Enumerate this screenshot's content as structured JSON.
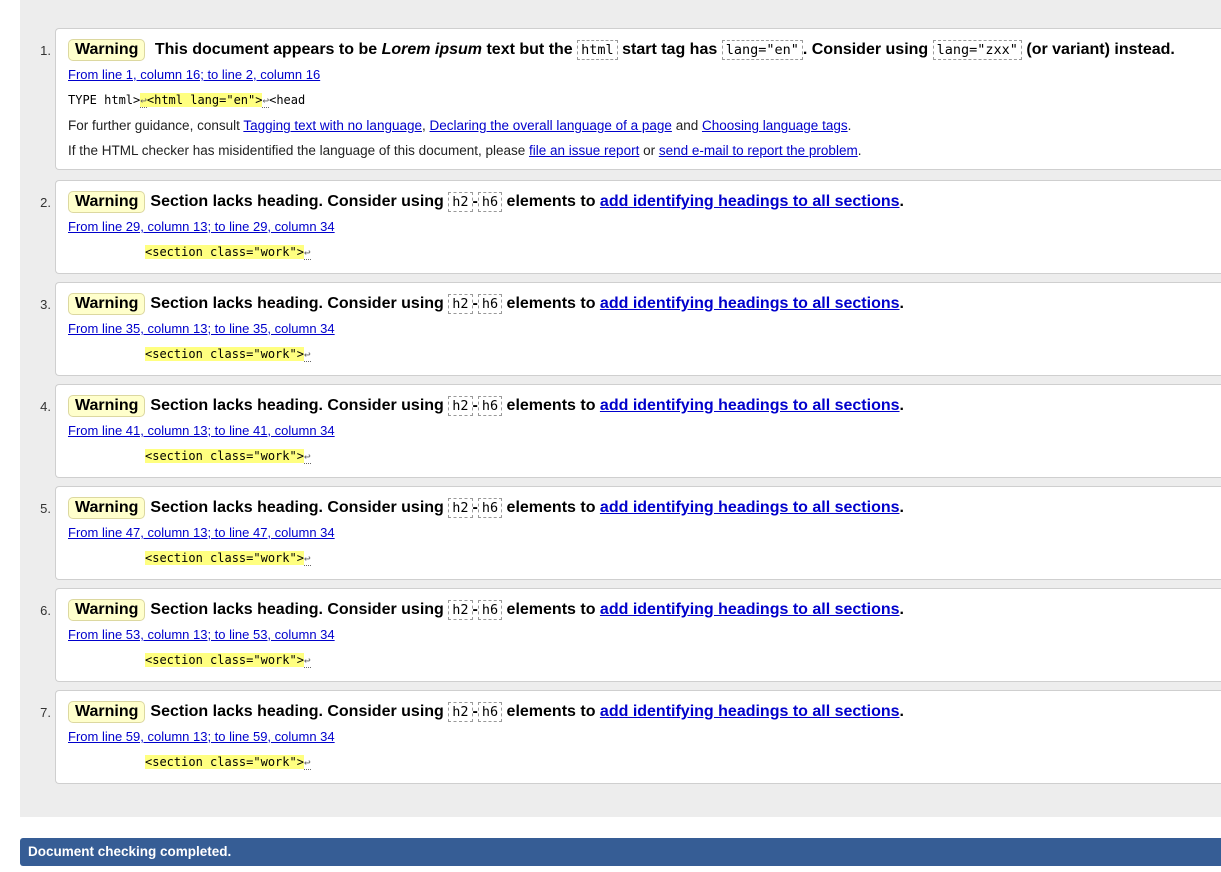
{
  "messages": [
    {
      "num": "1.",
      "badge": "Warning",
      "t1": "This document appears to be ",
      "em": "Lorem ipsum",
      "t2": " text but the ",
      "code1": "html",
      "t3": " start tag has ",
      "code2": "lang=\"en\"",
      "t4": ". Consider using ",
      "code3": "lang=\"zxx\"",
      "t5": " (or variant) instead.",
      "location": "From line 1, column 16; to line 2, column 16",
      "extract_pre": "TYPE html>",
      "extract_hl": "<html lang=\"en\">",
      "extract_post": "<head",
      "extract_rt": "↩",
      "guidance_prefix": "For further guidance, consult ",
      "guidance_link1": "Tagging text with no language",
      "guidance_comma": ", ",
      "guidance_link2": "Declaring the overall language of a page",
      "guidance_and": " and ",
      "guidance_link3": "Choosing language tags",
      "guidance_end": ".",
      "report_prefix": "If the HTML checker has misidentified the language of this document, please ",
      "report_link1": "file an issue report",
      "report_or": " or ",
      "report_link2": "send e-mail to report the problem",
      "report_end": "."
    }
  ],
  "section_warnings": [
    {
      "num": "2.",
      "location": "From line 29, column 13; to line 29, column 34"
    },
    {
      "num": "3.",
      "location": "From line 35, column 13; to line 35, column 34"
    },
    {
      "num": "4.",
      "location": "From line 41, column 13; to line 41, column 34"
    },
    {
      "num": "5.",
      "location": "From line 47, column 13; to line 47, column 34"
    },
    {
      "num": "6.",
      "location": "From line 53, column 13; to line 53, column 34"
    },
    {
      "num": "7.",
      "location": "From line 59, column 13; to line 59, column 34"
    }
  ],
  "section_template": {
    "badge": "Warning",
    "text1": "Section lacks heading. Consider using ",
    "code_a": "h2",
    "dash": "-",
    "code_b": "h6",
    "text2": " elements to ",
    "link": "add identifying headings to all sections",
    "end": ".",
    "extract": "<section class=\"work\">",
    "extract_rt": "↩"
  },
  "status": {
    "completed": "Document checking completed."
  },
  "colors": {
    "panel_bg": "#ededed",
    "badge_bg": "#ffffcc",
    "highlight": "#ffff80",
    "status_bar": "#365d95",
    "link": "#0000cc"
  }
}
